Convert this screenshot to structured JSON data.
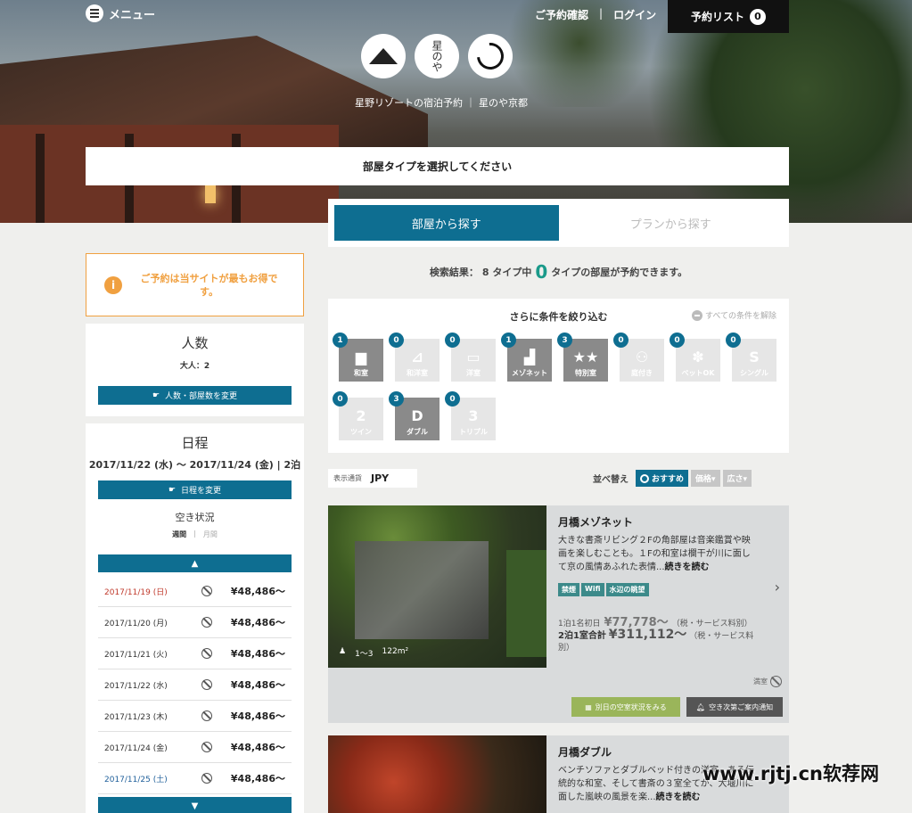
{
  "header": {
    "menu_label": "メニュー",
    "link_confirm": "ご予約確認",
    "separator": "|",
    "link_login": "ログイン",
    "reserve_list_label": "予約リスト",
    "reserve_list_count": "0",
    "logo_text": "星のや",
    "subtitle": "星野リゾートの宿泊予約 ｜ 星のや京都"
  },
  "select_bar": {
    "label": "部屋タイプを選択してください"
  },
  "tabs": [
    {
      "label": "部屋から探す",
      "active": true
    },
    {
      "label": "プランから探す",
      "active": false
    }
  ],
  "result": {
    "prefix": "検索結果：",
    "types": "8 タイプ中",
    "count": "0",
    "suffix": "タイプの部屋が予約できます。"
  },
  "filters": {
    "heading": "さらに条件を絞り込む",
    "clear_label": "すべての条件を解除",
    "items": [
      {
        "label": "和室",
        "count": "1",
        "on": true,
        "icon": "japanese-room-icon",
        "sym": "▆"
      },
      {
        "label": "和洋室",
        "count": "0",
        "on": false,
        "icon": "mixed-room-icon",
        "sym": "⊿"
      },
      {
        "label": "洋室",
        "count": "0",
        "on": false,
        "icon": "western-room-icon",
        "sym": "▭"
      },
      {
        "label": "メゾネット",
        "count": "1",
        "on": true,
        "icon": "stairs-icon",
        "sym": "▟"
      },
      {
        "label": "特別室",
        "count": "3",
        "on": true,
        "icon": "stars-icon",
        "sym": "★★"
      },
      {
        "label": "庭付き",
        "count": "0",
        "on": false,
        "icon": "footprints-icon",
        "sym": "⚇"
      },
      {
        "label": "ペットOK",
        "count": "0",
        "on": false,
        "icon": "paw-icon",
        "sym": "✽"
      },
      {
        "label": "シングル",
        "count": "0",
        "on": false,
        "icon": "single-bed-icon",
        "sym": "S"
      },
      {
        "label": "ツイン",
        "count": "0",
        "on": false,
        "icon": "twin-bed-icon",
        "sym": "2"
      },
      {
        "label": "ダブル",
        "count": "3",
        "on": true,
        "icon": "double-bed-icon",
        "sym": "D"
      },
      {
        "label": "トリプル",
        "count": "0",
        "on": false,
        "icon": "triple-bed-icon",
        "sym": "3"
      }
    ]
  },
  "currency": {
    "label": "表示通貨",
    "value": "JPY"
  },
  "sort": {
    "label": "並べ替え",
    "options": [
      "おすすめ",
      "価格▾",
      "広さ▾"
    ]
  },
  "rooms": [
    {
      "title": "月橋メゾネット",
      "desc": "大きな書斎リビング２Fの角部屋は音楽鑑賞や映画を楽しむことも。１Fの和室は欄干が川に面して京の風情あふれた表情...",
      "more": "続きを読む",
      "tags": [
        "禁煙",
        "Wifi",
        "水辺の眺望"
      ],
      "capacity": "1～3",
      "area": "122m²",
      "price1_label": "1泊1名初日",
      "price1": "¥77,778〜",
      "tax": "（税・サービス料別）",
      "price2_label": "2泊1室合計",
      "price2": "¥311,112〜",
      "status": "満室",
      "btn_other": "別日の空室状況をみる",
      "btn_notify": "空き次第ご案内通知"
    },
    {
      "title": "月橋ダブル",
      "desc": "ベンチソファとダブルベッド付きの洋室、ある伝統的な和室、そして書斎の３室全てが、大堰川に面した嵐峡の風景を楽...",
      "more": "続きを読む"
    }
  ],
  "sidebar": {
    "alert": "ご予約は当サイトが最もお得です。",
    "guests": {
      "title": "人数",
      "detail": "大人：2",
      "button": "人数・部屋数を変更"
    },
    "schedule": {
      "title": "日程",
      "dates": "2017/11/22 (水) 〜 2017/11/24 (金) | 2泊",
      "button": "日程を変更",
      "availability": "空き状況",
      "view_week": "週間",
      "view_sep": "|",
      "view_month": "月間",
      "up": "▲",
      "down": "▼",
      "days": [
        {
          "date": "2017/11/19 (日)",
          "price": "¥48,486〜",
          "color": "#c0392b"
        },
        {
          "date": "2017/11/20 (月)",
          "price": "¥48,486〜",
          "color": "#333333"
        },
        {
          "date": "2017/11/21 (火)",
          "price": "¥48,486〜",
          "color": "#333333"
        },
        {
          "date": "2017/11/22 (水)",
          "price": "¥48,486〜",
          "color": "#333333"
        },
        {
          "date": "2017/11/23 (木)",
          "price": "¥48,486〜",
          "color": "#333333"
        },
        {
          "date": "2017/11/24 (金)",
          "price": "¥48,486〜",
          "color": "#333333"
        },
        {
          "date": "2017/11/25 (土)",
          "price": "¥48,486〜",
          "color": "#1f5f9a"
        }
      ]
    }
  },
  "watermark": "www.rjtj.cn软荐网"
}
